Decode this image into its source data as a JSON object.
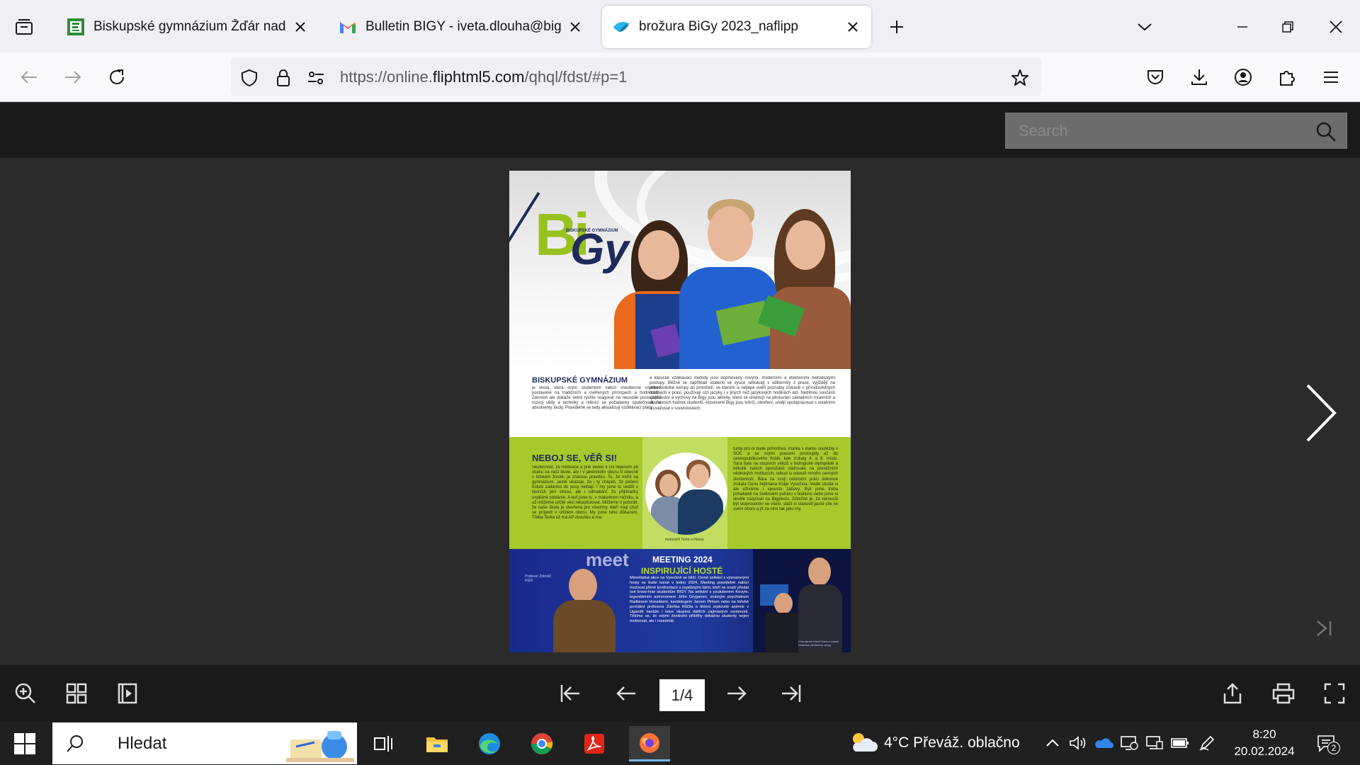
{
  "tabs": [
    {
      "title": "Biskupské gymnázium Žďár nad Sázavou",
      "active": false
    },
    {
      "title": "Bulletin BIGY - iveta.dlouha@bigyzdar.cz",
      "active": false
    },
    {
      "title": "brožura BiGy 2023_naflipp",
      "active": true
    }
  ],
  "url": {
    "prefix": "https://online.",
    "host": "fliphtml5.com",
    "path": "/qhql/fdst/#p=1"
  },
  "viewer": {
    "search_placeholder": "Search",
    "page_indicator": "1/4"
  },
  "brochure": {
    "logo_letters_1": "Bi",
    "logo_letters_2": "Gy",
    "logo_sub": "BISKUPSKÉ GYMNÁZIUM",
    "intro_title": "BISKUPSKÉ GYMNÁZIUM",
    "intro_text_1": "je škola, která svým studentům nabízí všeobecné vzdělání postavené na tradičních a ověřených principech a hodnotách. Zároveň ale dokáže velmi rychle reagovat na neustále postupující rozvoj vědy a techniky a měnící se požadavky společnosti na absolventy školy. Pravidelně se tedy aktualizují vzdělávací plány",
    "intro_text_2": "a klasické vzdělávací metody jsou doplňovány novými, moderními a efektivními metodickými postupy. Běžně se například studenti ve výuce setkávají s odborníky z praxe, vyjíždějí na přírodovědné kempy do prostředí, ve kterém si nejlépe ověří poznatky získané v přírodovědných hodinách v praxi, používají cizí jazyky i v jiných než jazykových hodinách atd. Nedílnou součástí vzdělávání a výchovy na Bigy jsou aktivity, které se orientují na pěstování základních mravních a duchovních hodnot studentů. Absolventi Bigy jsou tvůrčí, otevření, umějí spolupracovat s ostatními a uvažovat v souvislostech.",
    "green_title": "NEBOJ SE, VĚŘ SI!",
    "green_text_1": "Skutečnost, že motivace a píle vedou k cíli nejenom při studiu na naší škole, ale i v jakémkoliv oboru či obecně v lidském životě, je známou pravdou. To, že míříš na gymnázium, jasně ukazuje, že i ty chápeš, že pečení holubi zadarmo do pusy nelítají. I my jsme tu seděli v lavicích plní stresu, ale i odhodlání, že přijímačky úspěšně zdoláme. A teď jsme tu, v maturitním ročníku, a už můžeme určitě věci rekapitulovat. Můžeme ti potvrdit, že naše škola je otevřená pro všechny, kteří mají chuť se projevit v určitém oboru. My jsme toho důkazem. Třeba Terka už má AP zkoušku a ma-",
    "green_text_2": "turita pro ni bude pohodová. Klárka s Bárou soutěžily v SOČ a se svými pracemi postoupily až do celorepublikového finále, kde získaly 4. a 8. místo. Sára byla na stupních vítězů v biologické olympiádě a několik našich spolužáků stážovalo na prestižních vědeckých institucích, odkud si odvezli mnoho cenných zkušeností. Bára za svoji celoroční práci dokonce získala Cenu hejtmana Kraje Vysočina. Vedle studia si ale užíváme i spoustu zábavy. Byli jsme třeba pořadateli na Světovém poháru v biatlonu nebo jsme si skvěle zazpívali na Bigyfestu. Důležité je, že nemusíš být stoprocentní ve všem, stačí si stanovit jasné cíle ve svém oboru a jít za nimi tak jako my.",
    "green_caption": "maturanti Terka a Honza",
    "meet_word": "meet",
    "meeting_title_1": "MEETING 2024",
    "meeting_title_2": "INSPIRUJÍCÍ HOSTÉ",
    "meeting_text": "Mimořádná akce na Vysočině se blíží. Osmé setkání s významnými hosty se bude konat v lednu 2024. Meeting pravidelně nabízí možnost přímé konfrontace s úspěšnými lidmi, kteří se snaží předat své know-how studentům BIGY. Na setkání s youtuberem Kovym, legendárním astronomem Jiřím Grygarem, známým psychiatrem Radkinem Honzákem, kardiologem Janem Pirkem nebo na loňské povídání profesora Zdeňka Růčila o léčení srpkovité anémie v Ugandě naváže i letos skupina dalších zajímavých osobností. Těšíme se, že svými životními příběhy dokážou studenty nejen motivovat, ale i rozesmát.",
    "meeting_caption_1": "Profesor Zdeněk Růčil",
    "meeting_caption_2": "Chemikové Kamil Kuča a Lukáš Kostrhun (Nobelovy ceny)"
  },
  "taskbar": {
    "search_label": "Hledat",
    "weather": "4°C  Převáž. oblačno",
    "time": "8:20",
    "date": "20.02.2024",
    "notifications": "2"
  },
  "colors": {
    "brand_green": "#a6c92c",
    "brand_navy": "#1f2b5c",
    "meeting_blue": "#1f3a9d",
    "viewer_bg": "#2b2b2b"
  }
}
